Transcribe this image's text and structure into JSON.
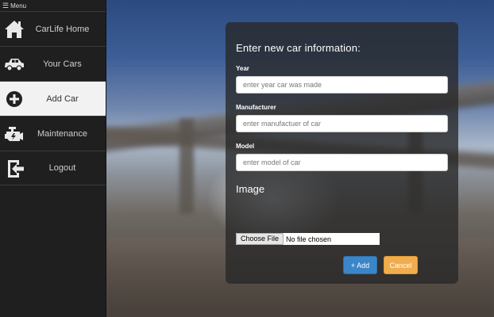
{
  "menu": {
    "icon": "hamburger-icon",
    "label": "Menu"
  },
  "sidebar": {
    "items": [
      {
        "label": "CarLife Home",
        "icon": "home-icon",
        "active": false
      },
      {
        "label": "Your Cars",
        "icon": "car-icon",
        "active": false
      },
      {
        "label": "Add Car",
        "icon": "plus-circle-icon",
        "active": true
      },
      {
        "label": "Maintenance",
        "icon": "engine-icon",
        "active": false
      },
      {
        "label": "Logout",
        "icon": "logout-icon",
        "active": false
      }
    ]
  },
  "form": {
    "title": "Enter new car information:",
    "year": {
      "label": "Year",
      "placeholder": "enter year car was made",
      "value": ""
    },
    "manufacturer": {
      "label": "Manufacturer",
      "placeholder": "enter manufactuer of car",
      "value": ""
    },
    "model": {
      "label": "Model",
      "placeholder": "enter model of car",
      "value": ""
    },
    "image": {
      "label": "Image",
      "choose_label": "Choose File",
      "status": "No file chosen"
    },
    "add_label": "+ Add",
    "cancel_label": "Cancel"
  },
  "colors": {
    "sidebar_bg": "#1f1f1f",
    "active_item_bg": "#f2f2f2",
    "add_button": "#3b86c8",
    "cancel_button": "#f0ad4e"
  }
}
